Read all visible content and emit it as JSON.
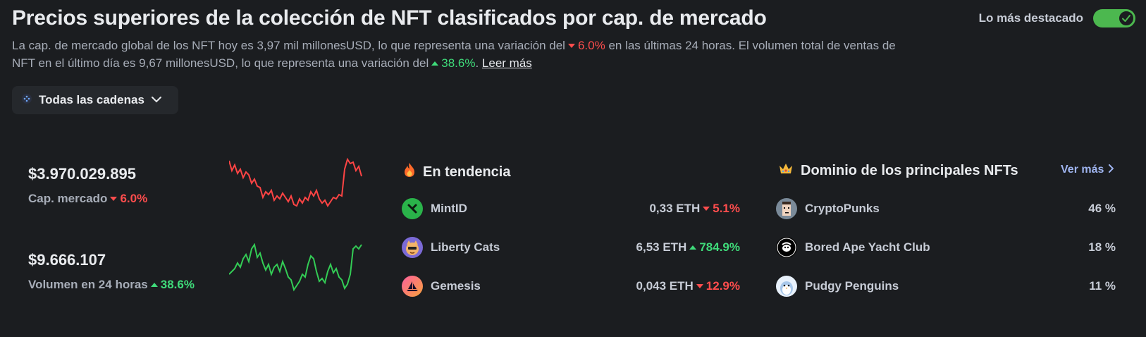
{
  "header": {
    "title": "Precios superiores de la colección de NFT clasificados por cap. de mercado",
    "toggle_label": "Lo más destacado",
    "toggle_on": true
  },
  "description": {
    "part1": "La cap. de mercado global de los NFT hoy es 3,97 mil millonesUSD, lo que representa una variación del",
    "change1": "6.0%",
    "part2": "en las últimas 24 horas. El volumen total de ventas de NFT en el último día es 9,67 millonesUSD, lo que representa una variación del",
    "change2": "38.6%",
    "part3": ".",
    "read_more": "Leer más"
  },
  "chain_filter": {
    "label": "Todas las cadenas"
  },
  "stats": {
    "market_cap": {
      "value": "$3.970.029.895",
      "label": "Cap. mercado",
      "change": "6.0%",
      "direction": "down"
    },
    "volume": {
      "value": "$9.666.107",
      "label": "Volumen en 24 horas",
      "change": "38.6%",
      "direction": "up"
    }
  },
  "trending": {
    "title": "En tendencia",
    "items": [
      {
        "name": "MintID",
        "price": "0,33 ETH",
        "change": "5.1%",
        "direction": "down",
        "icon": "mintid-icon"
      },
      {
        "name": "Liberty Cats",
        "price": "6,53 ETH",
        "change": "784.9%",
        "direction": "up",
        "icon": "liberty-cats-icon"
      },
      {
        "name": "Gemesis",
        "price": "0,043 ETH",
        "change": "12.9%",
        "direction": "down",
        "icon": "gemesis-icon"
      }
    ]
  },
  "dominance": {
    "title": "Dominio de los principales NFTs",
    "see_more": "Ver más",
    "items": [
      {
        "name": "CryptoPunks",
        "share": "46 %",
        "icon": "cryptopunks-icon"
      },
      {
        "name": "Bored Ape Yacht Club",
        "share": "18 %",
        "icon": "bayc-icon"
      },
      {
        "name": "Pudgy Penguins",
        "share": "11 %",
        "icon": "pudgy-penguins-icon"
      }
    ]
  },
  "colors": {
    "down": "#ff4d4d",
    "up": "#3fdb7a",
    "accent": "#4cb84f",
    "link": "#9fb4ef"
  }
}
